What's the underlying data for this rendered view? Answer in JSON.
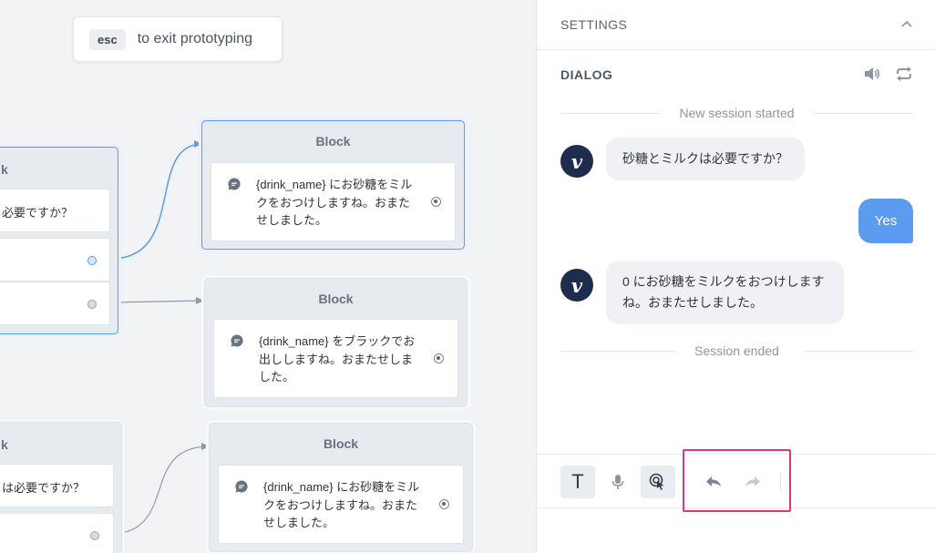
{
  "canvas": {
    "esc_key": "esc",
    "esc_text": "to exit prototyping",
    "left_block_top": {
      "title_fragment": "k",
      "choice_fragment": "必要ですか？"
    },
    "left_block_bottom": {
      "title_fragment": "k",
      "choice_fragment": "は必要ですか？"
    },
    "blocks": [
      {
        "title": "Block",
        "text": "{drink_name} にお砂糖をミルクをおつけしますね。おまたせしました。"
      },
      {
        "title": "Block",
        "text": "{drink_name} をブラックでお出ししますね。おまたせしました。"
      },
      {
        "title": "Block",
        "text": "{drink_name} にお砂糖をミルクをおつけしますね。おまたせしました。"
      }
    ]
  },
  "panel": {
    "settings_label": "SETTINGS",
    "dialog_label": "DIALOG",
    "session_started": "New session started",
    "session_ended": "Session ended",
    "messages": [
      {
        "from": "system",
        "text": "砂糖とミルクは必要ですか？"
      },
      {
        "from": "user",
        "text": "Yes"
      },
      {
        "from": "system",
        "text": "0 にお砂糖をミルクをおつけしますね。おまたせしました。"
      }
    ],
    "avatar_letter": "v",
    "toolbar": {
      "text_mode_label": "T",
      "icons": [
        "text-mode-icon",
        "microphone-icon",
        "touch-icon",
        "undo-icon",
        "redo-icon"
      ]
    }
  },
  "colors": {
    "accent_blue": "#5b9cf0",
    "avatar_navy": "#1e2d4d",
    "highlight_pink": "#e4357a"
  }
}
